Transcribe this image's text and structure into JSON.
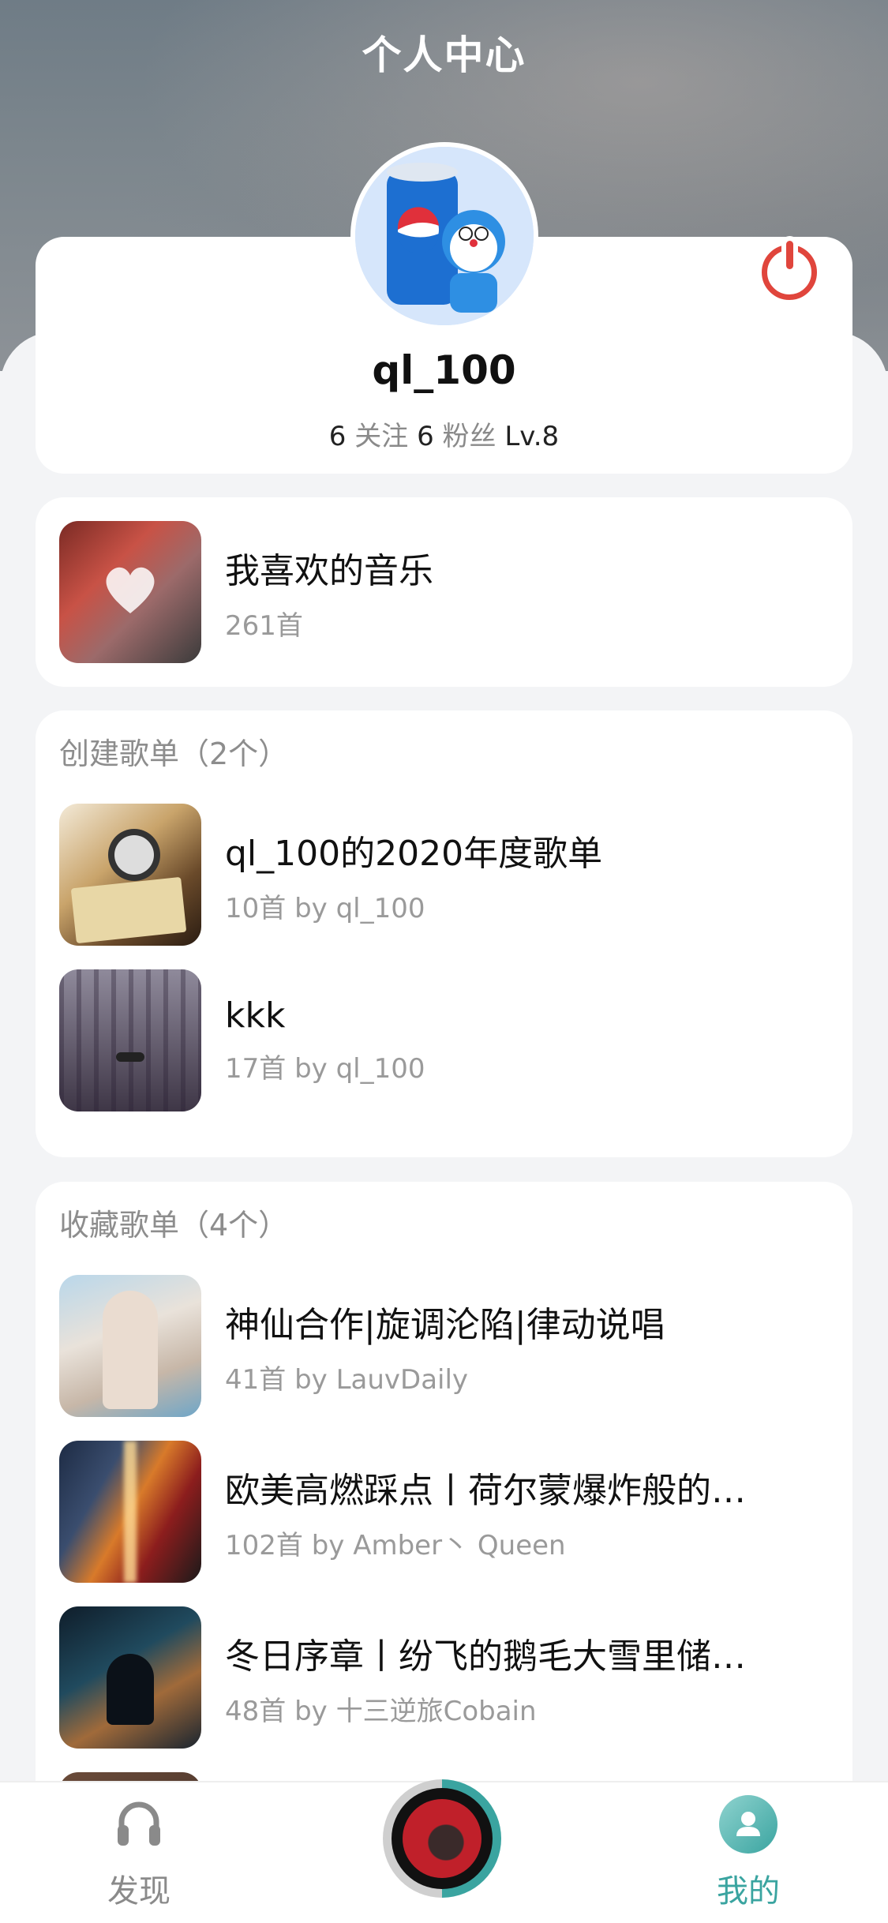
{
  "header": {
    "title": "个人中心"
  },
  "profile": {
    "username": "ql_100",
    "following_count": "6",
    "following_label": "关注",
    "followers_count": "6",
    "followers_label": "粉丝",
    "level": "Lv.8"
  },
  "liked_music": {
    "title": "我喜欢的音乐",
    "count": "261首"
  },
  "created_playlists": {
    "section_title": "创建歌单（2个）",
    "items": [
      {
        "title": "ql_100的2020年度歌单",
        "subtitle": "10首 by ql_100"
      },
      {
        "title": "kkk",
        "subtitle": "17首 by ql_100"
      }
    ]
  },
  "favorite_playlists": {
    "section_title": "收藏歌单（4个）",
    "items": [
      {
        "title": "神仙合作|旋调沦陷|律动说唱",
        "subtitle": "41首 by LauvDaily"
      },
      {
        "title": "欧美高燃踩点丨荷尔蒙爆炸般的…",
        "subtitle": "102首 by Amber丶 Queen"
      },
      {
        "title": "冬日序章丨纷飞的鹅毛大雪里储…",
        "subtitle": "48首 by 十三逆旅Cobain"
      }
    ]
  },
  "tabbar": {
    "discover_label": "发现",
    "mine_label": "我的",
    "active_color": "#3aa4a0",
    "inactive_color": "#8a8a8a"
  },
  "icons": [
    "power-icon",
    "heart-icon",
    "headphones-icon",
    "user-icon",
    "now-playing-disc"
  ]
}
